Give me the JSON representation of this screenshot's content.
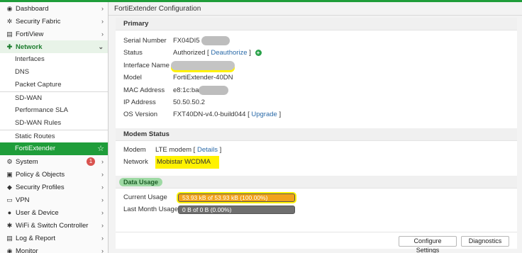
{
  "sidebar": {
    "items": [
      {
        "label": "Dashboard",
        "icon": "gauge-icon"
      },
      {
        "label": "Security Fabric",
        "icon": "fabric-icon"
      },
      {
        "label": "FortiView",
        "icon": "chart-icon"
      },
      {
        "label": "Network",
        "icon": "plus-icon"
      },
      {
        "label": "Interfaces"
      },
      {
        "label": "DNS"
      },
      {
        "label": "Packet Capture"
      },
      {
        "label": "SD-WAN"
      },
      {
        "label": "Performance SLA"
      },
      {
        "label": "SD-WAN Rules"
      },
      {
        "label": "Static Routes"
      },
      {
        "label": "FortiExtender"
      },
      {
        "label": "System",
        "icon": "gear-icon",
        "badge": "1"
      },
      {
        "label": "Policy & Objects",
        "icon": "policy-icon"
      },
      {
        "label": "Security Profiles",
        "icon": "lock-icon"
      },
      {
        "label": "VPN",
        "icon": "vpn-icon"
      },
      {
        "label": "User & Device",
        "icon": "user-icon"
      },
      {
        "label": "WiFi & Switch Controller",
        "icon": "wifi-icon"
      },
      {
        "label": "Log & Report",
        "icon": "chart-icon"
      },
      {
        "label": "Monitor",
        "icon": "monitor-icon"
      }
    ]
  },
  "header": {
    "title": "FortiExtender Configuration"
  },
  "primary": {
    "section_title": "Primary",
    "serial_label": "Serial Number",
    "serial_value": "FX04DI5",
    "status_label": "Status",
    "status_value": "Authorized",
    "deauthorize_link": "Deauthorize",
    "interface_label": "Interface Name",
    "model_label": "Model",
    "model_value": "FortiExtender-40DN",
    "mac_label": "MAC Address",
    "mac_value": "e8:1c:ba",
    "ip_label": "IP Address",
    "ip_value": "50.50.50.2",
    "os_label": "OS Version",
    "os_value": "FXT40DN-v4.0-build044",
    "upgrade_link": "Upgrade"
  },
  "modem": {
    "section_title": "Modem Status",
    "modem_label": "Modem",
    "modem_value": "LTE modem",
    "details_link": "Details",
    "network_label": "Network",
    "network_value": "Mobistar WCDMA"
  },
  "data_usage": {
    "section_title": "Data Usage",
    "current_label": "Current Usage",
    "current_text": "53.93 kB of 53.93 kB (100.00%)",
    "current_fraction": 1.0,
    "last_label": "Last Month Usage",
    "last_text": "0 B of 0 B (0.00%)",
    "last_fraction": 0.0
  },
  "buttons": {
    "configure_settings": "Configure Settings",
    "diagnostics": "Diagnostics"
  },
  "colors": {
    "accent": "#1f9d3a",
    "highlight": "#fff200",
    "usage_fill": "#f2a31b"
  }
}
